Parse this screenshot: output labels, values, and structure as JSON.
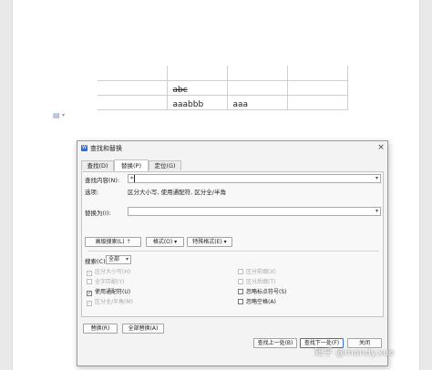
{
  "document": {
    "table_rows": [
      [
        "",
        "",
        "",
        ""
      ],
      [
        "",
        "abc",
        "",
        ""
      ],
      [
        "",
        "aaabbb",
        "aaa",
        ""
      ]
    ]
  },
  "dialog": {
    "title": "查找和替换",
    "close": "×",
    "tabs": [
      "查找(D)",
      "替换(P)",
      "定位(G)"
    ],
    "active_tab": 1,
    "find_label": "查找内容(N):",
    "find_value": "*",
    "options_label": "选项:",
    "options_value": "区分大小写, 使用通配符, 区分全/半角",
    "replace_label": "替换为(I):",
    "replace_value": "",
    "btn_advanced": "高级搜索(L) ⇡",
    "btn_format": "格式(O) ▾",
    "btn_special": "特殊格式(E) ▾",
    "search_label": "搜索(C)",
    "search_value": "全部",
    "checkboxes_left": [
      {
        "label": "区分大小写(H)",
        "checked": true,
        "disabled": true
      },
      {
        "label": "全字匹配(Y)",
        "checked": false,
        "disabled": true
      },
      {
        "label": "使用通配符(U)",
        "checked": true,
        "disabled": false
      },
      {
        "label": "区分全/半角(M)",
        "checked": true,
        "disabled": true
      }
    ],
    "checkboxes_right": [
      {
        "label": "区分前缀(X)",
        "checked": false,
        "disabled": true
      },
      {
        "label": "区分后缀(T)",
        "checked": false,
        "disabled": true
      },
      {
        "label": "忽略标点符号(S)",
        "checked": false,
        "disabled": false
      },
      {
        "label": "忽略空格(A)",
        "checked": false,
        "disabled": false
      }
    ],
    "btn_replace": "替换(R)",
    "btn_replace_all": "全部替换(A)",
    "btn_find_prev": "查找上一处(B)",
    "btn_find_next": "查找下一处(F)",
    "btn_close": "关闭"
  },
  "watermark": "知乎 @mondy.xue",
  "colors": {
    "accent": "#2f6fdc"
  }
}
